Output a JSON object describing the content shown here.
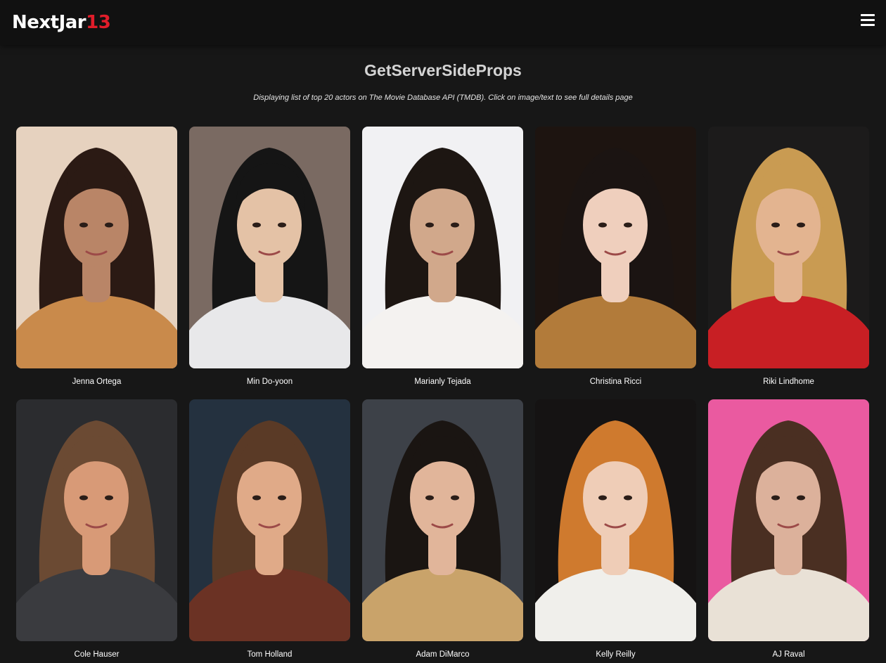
{
  "brand": {
    "text": "NextJar",
    "accent": "13",
    "accent_color": "#e11d2a"
  },
  "menu_icon": "hamburger-menu-icon",
  "page": {
    "title": "GetServerSideProps",
    "subtitle": "Displaying list of top 20 actors on The Movie Database API (TMDB). Click on image/text to see full details page"
  },
  "actors": [
    {
      "name": "Jenna Ortega",
      "bg": "#e6d2bf",
      "hair": "#2b1a14",
      "skin": "#b98567",
      "clothes": "#c98a4b"
    },
    {
      "name": "Min Do-yoon",
      "bg": "#7a6a62",
      "hair": "#151515",
      "skin": "#e4c2a6",
      "clothes": "#e8e8ea"
    },
    {
      "name": "Marianly Tejada",
      "bg": "#f1f1f3",
      "hair": "#1d1612",
      "skin": "#d1a88b",
      "clothes": "#f4f2f0"
    },
    {
      "name": "Christina Ricci",
      "bg": "#1d1410",
      "hair": "#1b1412",
      "skin": "#efcfbd",
      "clothes": "#b27b3a"
    },
    {
      "name": "Riki Lindhome",
      "bg": "#1c1b1b",
      "hair": "#c99b52",
      "skin": "#e3b490",
      "clothes": "#c81f24"
    },
    {
      "name": "Cole Hauser",
      "bg": "#2b2c2f",
      "hair": "#6b4a33",
      "skin": "#d89a77",
      "clothes": "#3a3b3f"
    },
    {
      "name": "Tom Holland",
      "bg": "#24313f",
      "hair": "#5a3a26",
      "skin": "#e0aa88",
      "clothes": "#6b3224"
    },
    {
      "name": "Adam DiMarco",
      "bg": "#3d4148",
      "hair": "#1a1512",
      "skin": "#e1b59a",
      "clothes": "#c9a36a"
    },
    {
      "name": "Kelly Reilly",
      "bg": "#151313",
      "hair": "#cf7a2e",
      "skin": "#efcdb7",
      "clothes": "#f0efeb"
    },
    {
      "name": "AJ Raval",
      "bg": "#ea5aa0",
      "hair": "#4a2f22",
      "skin": "#dcb19b",
      "clothes": "#e9e1d6"
    }
  ]
}
